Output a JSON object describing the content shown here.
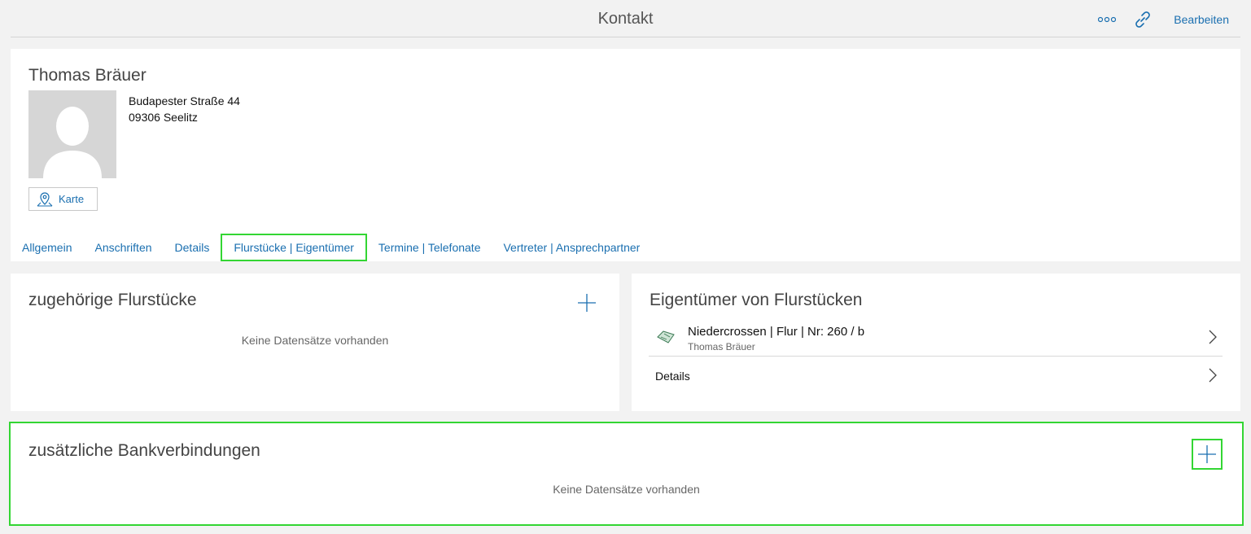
{
  "header": {
    "title": "Kontakt",
    "more_icon": "more-dots-icon",
    "link_icon": "link-icon",
    "edit_label": "Bearbeiten"
  },
  "profile": {
    "name": "Thomas Bräuer",
    "street": "Budapester Straße 44",
    "city": "09306 Seelitz",
    "map_button_label": "Karte"
  },
  "tabs": [
    {
      "label": "Allgemein",
      "active": false
    },
    {
      "label": "Anschriften",
      "active": false
    },
    {
      "label": "Details",
      "active": false
    },
    {
      "label": "Flurstücke | Eigentümer",
      "active": true
    },
    {
      "label": "Termine | Telefonate",
      "active": false
    },
    {
      "label": "Vertreter | Ansprechpartner",
      "active": false
    }
  ],
  "parcels": {
    "title": "zugehörige Flurstücke",
    "empty_text": "Keine Datensätze vorhanden"
  },
  "owners": {
    "title": "Eigentümer von Flurstücken",
    "item_main": "Niedercrossen | Flur | Nr: 260 / b",
    "item_sub": "Thomas Bräuer",
    "details_label": "Details"
  },
  "bank": {
    "title": "zusätzliche Bankverbindungen",
    "empty_text": "Keine Datensätze vorhanden"
  },
  "colors": {
    "accent": "#1a6fb0",
    "highlight": "#33d633",
    "background": "#f2f2f2"
  }
}
